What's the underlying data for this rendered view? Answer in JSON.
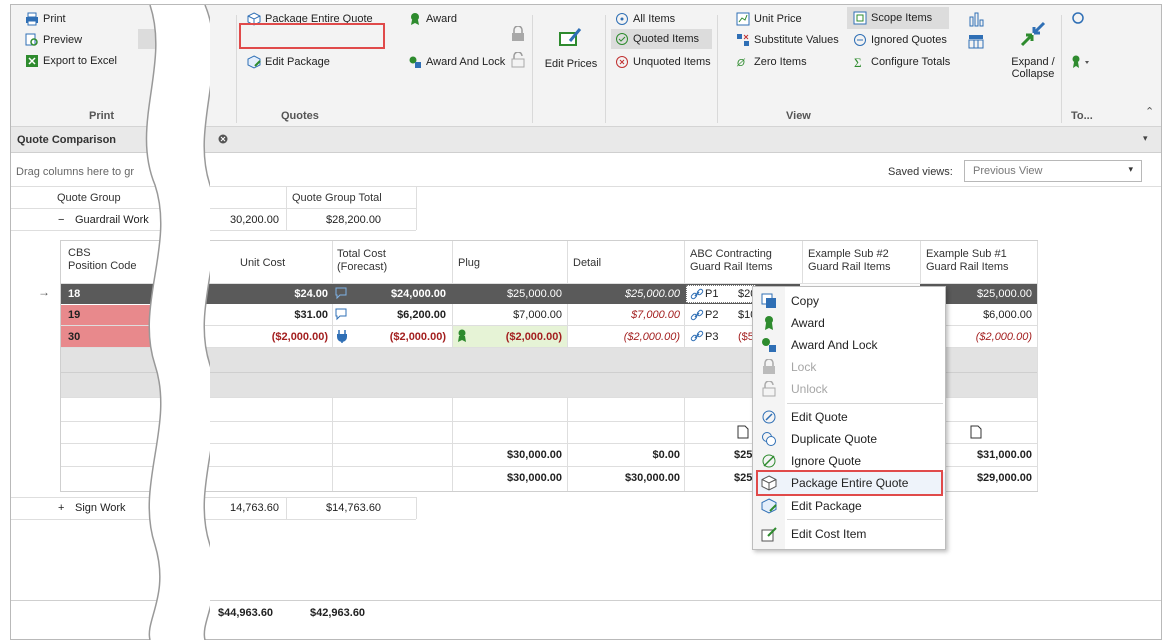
{
  "ribbon": {
    "print_group": {
      "title": "Print",
      "items": [
        "Print",
        "Preview",
        "Export to Excel"
      ]
    },
    "quotes_group": {
      "title": "Quotes",
      "package_entire_quote": "Package Entire Quote",
      "edit_package": "Edit Package",
      "award": "Award",
      "award_and_lock": "Award And Lock",
      "edit_prices": "Edit Prices"
    },
    "view_group": {
      "title": "View",
      "all_items": "All Items",
      "quoted_items": "Quoted Items",
      "unquoted_items": "Unquoted Items",
      "unit_price": "Unit Price",
      "substitute_values": "Substitute Values",
      "zero_items": "Zero Items",
      "scope_items": "Scope Items",
      "ignored_quotes": "Ignored Quotes",
      "configure_totals": "Configure Totals",
      "expand_collapse": "Expand / Collapse"
    },
    "to_group": {
      "title": "To..."
    }
  },
  "panel": {
    "title": "Quote Comparison"
  },
  "drag_hint": "Drag columns here to gr",
  "saved_views": {
    "label": "Saved views:",
    "value": "Previous View"
  },
  "outer_grid": {
    "headers": [
      "Quote Group",
      "Quote Group Total"
    ],
    "groups": [
      {
        "sign": "−",
        "name": "Guardrail Work",
        "c1": "30,200.00",
        "c2": "$28,200.00"
      },
      {
        "sign": "+",
        "name": "Sign Work",
        "c1": "14,763.60",
        "c2": "$14,763.60"
      }
    ],
    "footer": {
      "c1": "$44,963.60",
      "c2": "$42,963.60"
    }
  },
  "inner_grid": {
    "headers": {
      "cbs": "CBS",
      "position": "Position Code",
      "unit_cost": "Unit Cost",
      "total_cost": "Total Cost",
      "forecast": "(Forecast)",
      "plug": "Plug",
      "detail": "Detail",
      "abc": "ABC Contracting",
      "abc_sub": "Guard Rail Items",
      "ex2": "Example Sub #2",
      "ex2_sub": "Guard Rail Items",
      "ex1": "Example Sub #1",
      "ex1_sub": "Guard Rail Items"
    },
    "rows": [
      {
        "code": "18",
        "unit": "$24.00",
        "total": "$24,000.00",
        "plug": "$25,000.00",
        "detail": "$25,000.00",
        "abc_tag": "P1",
        "abc": "$20",
        "ex1": "$25,000.00"
      },
      {
        "code": "19",
        "unit": "$31.00",
        "total": "$6,200.00",
        "plug": "$7,000.00",
        "detail": "$7,000.00",
        "abc_tag": "P2",
        "abc": "$10",
        "ex1": "$6,000.00"
      },
      {
        "code": "30",
        "unit": "($2,000.00)",
        "total": "($2,000.00)",
        "plug": "($2,000.00)",
        "detail": "($2,000.00)",
        "abc_tag": "P3",
        "abc": "($5",
        "ex1": "($2,000.00)"
      }
    ],
    "totals": [
      {
        "plug": "$30,000.00",
        "detail": "$0.00",
        "abc": "$25",
        "ex1": "$31,000.00"
      },
      {
        "plug": "$30,000.00",
        "detail": "$30,000.00",
        "abc": "$25",
        "ex1": "$29,000.00"
      }
    ]
  },
  "context_menu": {
    "items": [
      {
        "label": "Copy",
        "enabled": true
      },
      {
        "label": "Award",
        "enabled": true
      },
      {
        "label": "Award And Lock",
        "enabled": true
      },
      {
        "label": "Lock",
        "enabled": false
      },
      {
        "label": "Unlock",
        "enabled": false
      },
      {
        "label": "Edit Quote",
        "enabled": true
      },
      {
        "label": "Duplicate Quote",
        "enabled": true
      },
      {
        "label": "Ignore Quote",
        "enabled": true
      },
      {
        "label": "Package Entire Quote",
        "enabled": true
      },
      {
        "label": "Edit Package",
        "enabled": true
      },
      {
        "label": "Edit Cost Item",
        "enabled": true
      }
    ]
  },
  "colors": {
    "selected_row": "#5a5a5a",
    "red_row": "#e8898c",
    "highlight": "#e04a4a",
    "plug_cell": "#e6f3d6",
    "icon_blue": "#2f6fb5",
    "icon_green": "#2e8b2e"
  }
}
